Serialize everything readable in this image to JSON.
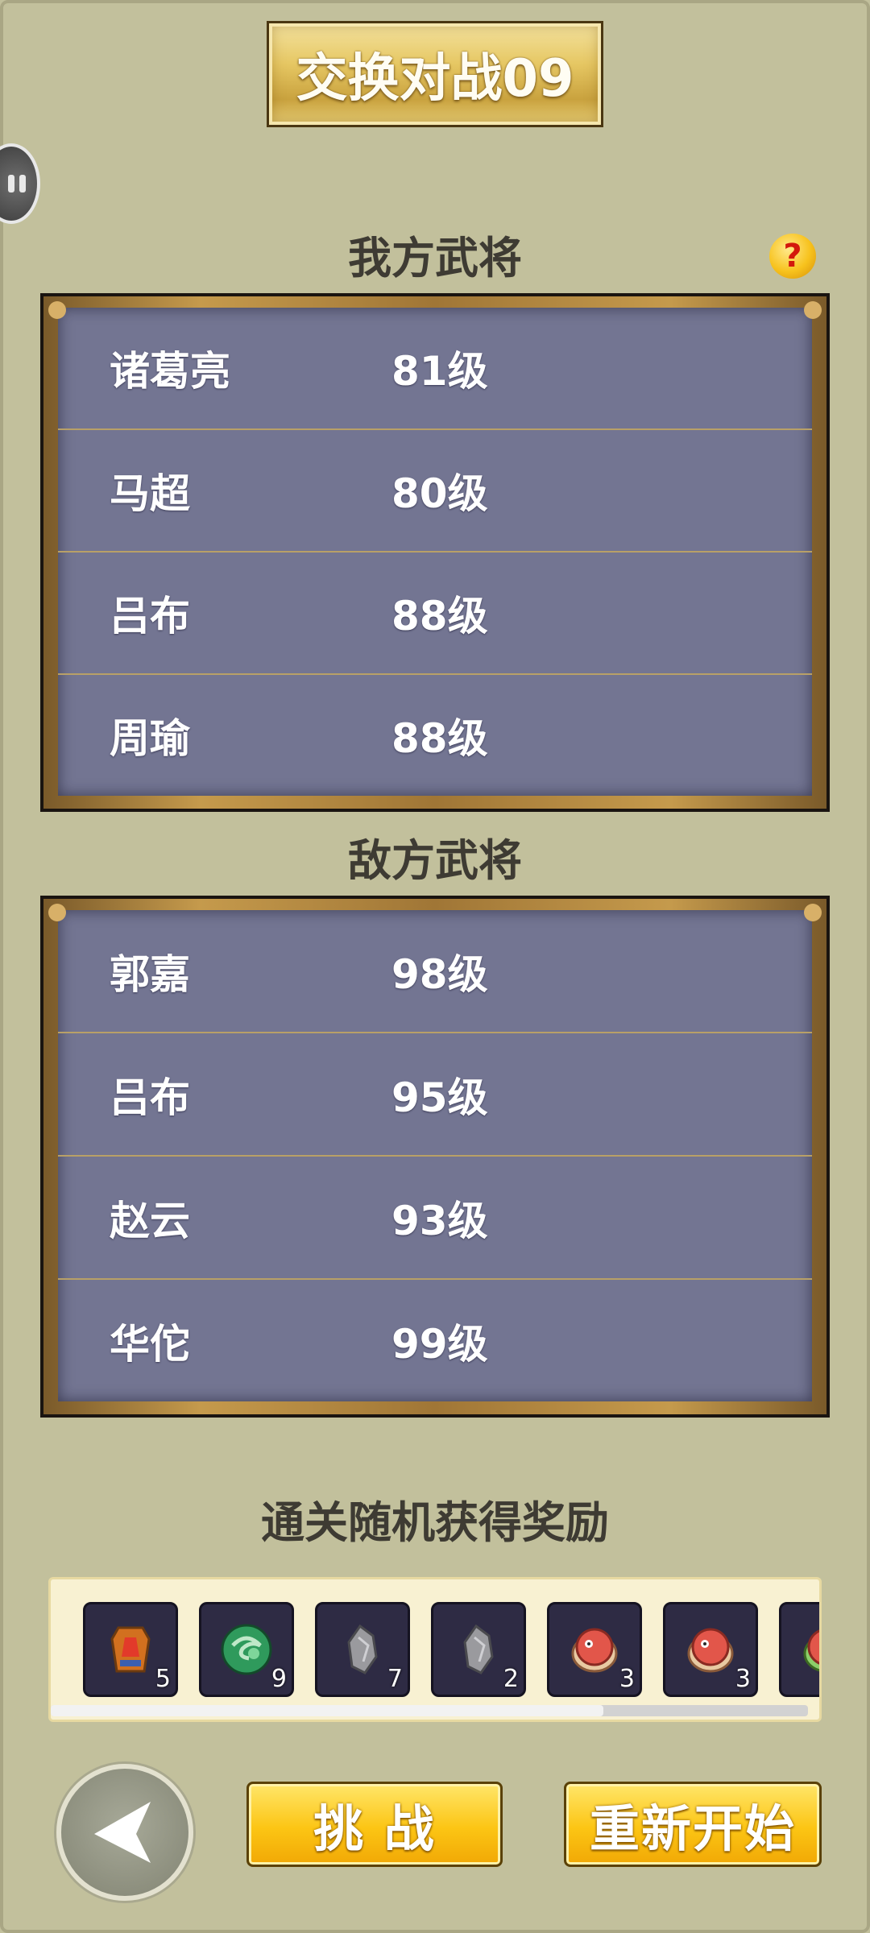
{
  "title": "交换对战09",
  "my_section": {
    "label": "我方武将",
    "generals": [
      {
        "name": "诸葛亮",
        "level": "81级"
      },
      {
        "name": "马超",
        "level": "80级"
      },
      {
        "name": "吕布",
        "level": "88级"
      },
      {
        "name": "周瑜",
        "level": "88级"
      }
    ]
  },
  "enemy_section": {
    "label": "敌方武将",
    "generals": [
      {
        "name": "郭嘉",
        "level": "98级"
      },
      {
        "name": "吕布",
        "level": "95级"
      },
      {
        "name": "赵云",
        "level": "93级"
      },
      {
        "name": "华佗",
        "level": "99级"
      }
    ]
  },
  "help_icon": {
    "glyph": "?"
  },
  "rewards": {
    "title": "通关随机获得奖励",
    "items": [
      {
        "icon": "armor-icon",
        "count": "5"
      },
      {
        "icon": "green-orb-icon",
        "count": "9"
      },
      {
        "icon": "stone-icon",
        "count": "7"
      },
      {
        "icon": "stone-icon",
        "count": "2"
      },
      {
        "icon": "peach-bun-icon",
        "count": "3"
      },
      {
        "icon": "peach-bun-icon",
        "count": "3"
      },
      {
        "icon": "peach-bun-icon",
        "count": ""
      }
    ],
    "scroll_fraction": 0.73
  },
  "buttons": {
    "challenge": "挑 战",
    "restart": "重新开始"
  },
  "colors": {
    "background": "#c2c09c",
    "row_fill": "#737592",
    "gold": "#fcc514"
  }
}
